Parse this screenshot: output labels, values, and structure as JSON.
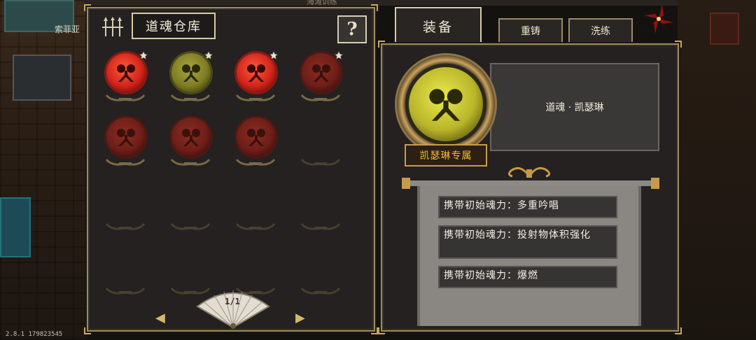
{
  "background": {
    "npc_label": "索菲亚",
    "top_label": "海滩训练"
  },
  "storage": {
    "title": "道魂仓库",
    "help_label": "?",
    "page": "1/1",
    "prev_arrow": "◀",
    "next_arrow": "▶",
    "slots": [
      {
        "state": "red-active",
        "starred": true
      },
      {
        "state": "olive",
        "starred": true
      },
      {
        "state": "red-active",
        "starred": true
      },
      {
        "state": "red-dim",
        "starred": true
      },
      {
        "state": "red-dim",
        "starred": false
      },
      {
        "state": "red-dim",
        "starred": false
      },
      {
        "state": "red-dim",
        "starred": false
      },
      {
        "state": "empty",
        "starred": false
      },
      {
        "state": "empty",
        "starred": false
      },
      {
        "state": "empty",
        "starred": false
      },
      {
        "state": "empty",
        "starred": false
      },
      {
        "state": "empty",
        "starred": false
      },
      {
        "state": "empty",
        "starred": false
      },
      {
        "state": "empty",
        "starred": false
      },
      {
        "state": "empty",
        "starred": false
      },
      {
        "state": "empty",
        "starred": false
      }
    ]
  },
  "tabs": {
    "equip": "装备",
    "recast": "重铸",
    "reroll": "洗练"
  },
  "equip": {
    "soul_name": "道魂 · 凯瑟琳",
    "exclusive": "凯瑟琳专属",
    "effects": [
      "携带初始魂力：多重吟唱",
      "携带初始魂力：投射物体积强化",
      "携带初始魂力：爆燃"
    ]
  },
  "footer": {
    "version": "2.8.1 179823545"
  },
  "colors": {
    "frame_gold": "#a08a5c",
    "exclusive_text": "#f0b93a",
    "orb_red": "#c8251c",
    "orb_olive": "#8a8a2a",
    "orb_yellow": "#e8ea4c",
    "pinwheel_red": "#e0242c"
  }
}
